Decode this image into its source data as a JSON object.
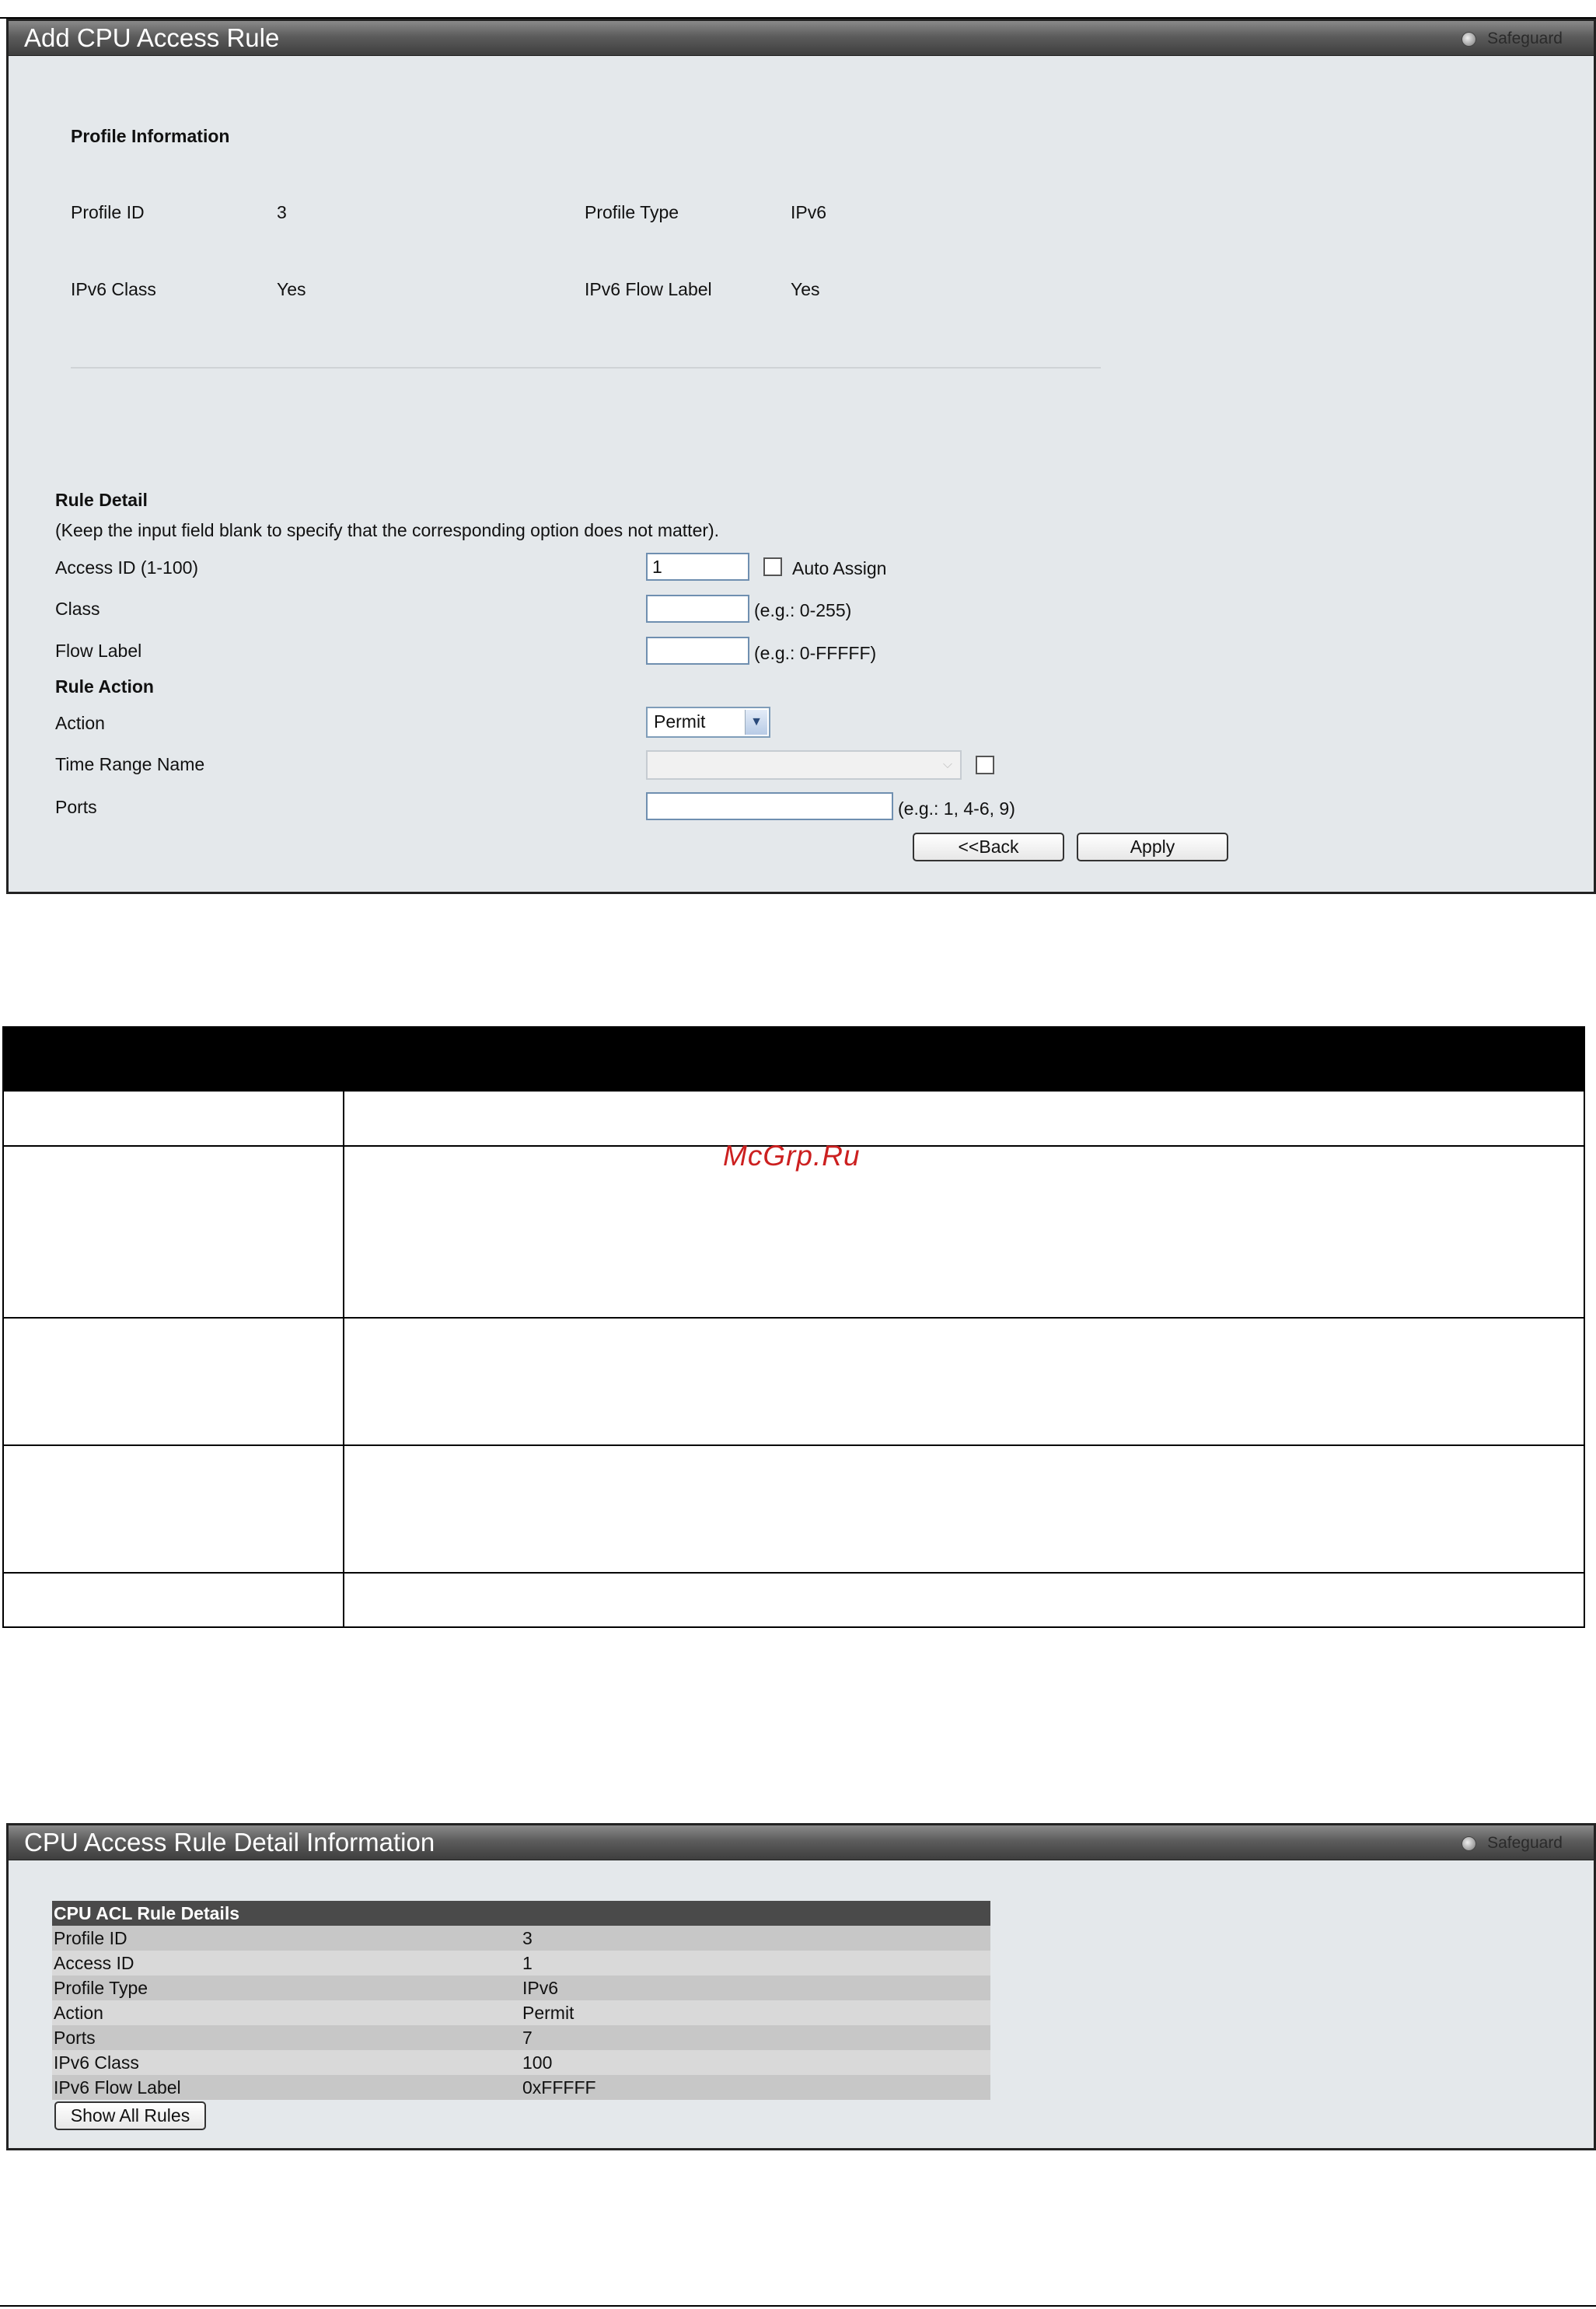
{
  "panel1": {
    "title": "Add CPU Access Rule",
    "safeguard": "Safeguard",
    "profile_heading": "Profile Information",
    "profile_id_label": "Profile ID",
    "profile_id_value": "3",
    "profile_type_label": "Profile Type",
    "profile_type_value": "IPv6",
    "ipv6_class_label": "IPv6 Class",
    "ipv6_class_value": "Yes",
    "ipv6_flow_label_label": "IPv6 Flow Label",
    "ipv6_flow_label_value": "Yes",
    "rule_detail_heading": "Rule Detail",
    "rule_detail_note": "(Keep the input field blank to specify that the corresponding option does not matter).",
    "access_id_label": "Access ID (1-100)",
    "access_id_value": "1",
    "auto_assign_label": "Auto Assign",
    "class_label": "Class",
    "class_value": "",
    "class_hint": "(e.g.: 0-255)",
    "flow_label_label": "Flow Label",
    "flow_label_value": "",
    "flow_label_hint": "(e.g.: 0-FFFFF)",
    "rule_action_heading": "Rule Action",
    "action_label": "Action",
    "action_value": "Permit",
    "time_range_label": "Time Range Name",
    "time_range_value": "",
    "ports_label": "Ports",
    "ports_value": "",
    "ports_hint": "(e.g.: 1, 4-6, 9)",
    "back_button": "<<Back",
    "apply_button": "Apply"
  },
  "watermark": "McGrp.Ru",
  "panel2": {
    "title": "CPU Access Rule Detail Information",
    "safeguard": "Safeguard",
    "table_heading": "CPU ACL Rule Details",
    "rows": [
      {
        "label": "Profile ID",
        "value": "3"
      },
      {
        "label": "Access ID",
        "value": "1"
      },
      {
        "label": "Profile Type",
        "value": "IPv6"
      },
      {
        "label": "Action",
        "value": "Permit"
      },
      {
        "label": "Ports",
        "value": "7"
      },
      {
        "label": "IPv6 Class",
        "value": "100"
      },
      {
        "label": "IPv6 Flow Label",
        "value": "0xFFFFF"
      }
    ],
    "show_all_button": "Show All Rules"
  }
}
